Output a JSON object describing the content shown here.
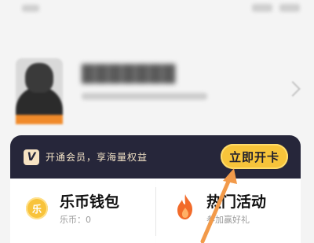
{
  "vip": {
    "logo_letter": "V",
    "promo_text": "开通会员，享海量权益",
    "open_button": "立即开卡"
  },
  "wallet": {
    "title": "乐币钱包",
    "coin_glyph": "乐",
    "balance_label": "乐币：0"
  },
  "activity": {
    "title": "热门活动",
    "subtitle": "参加赢好礼"
  },
  "colors": {
    "banner_bg": "#26263a",
    "button_yellow": "#f7c43a",
    "arrow_orange": "#f29a4a",
    "flame_orange": "#f26b2a"
  }
}
